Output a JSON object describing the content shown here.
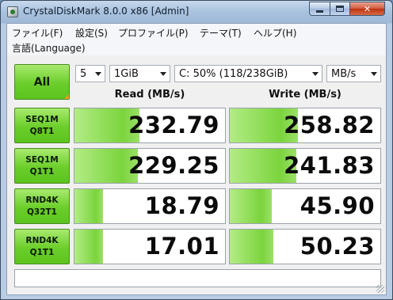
{
  "window": {
    "title": "CrystalDiskMark 8.0.0 x86 [Admin]",
    "caption_buttons": [
      "minimize-icon",
      "maximize-icon",
      "close-icon"
    ]
  },
  "menu": {
    "file": "ファイル(F)",
    "settings": "設定(S)",
    "profile": "プロファイル(P)",
    "theme": "テーマ(T)",
    "help": "ヘルプ(H)",
    "language": "言語(Language)"
  },
  "controls": {
    "all_label": "All",
    "count": "5",
    "size": "1GiB",
    "drive": "C: 50% (118/238GiB)",
    "unit": "MB/s"
  },
  "headers": {
    "read": "Read (MB/s)",
    "write": "Write (MB/s)"
  },
  "tests": [
    {
      "line1": "SEQ1M",
      "line2": "Q8T1",
      "read": "232.79",
      "write": "258.82",
      "read_fill": 0.43,
      "write_fill": 0.45
    },
    {
      "line1": "SEQ1M",
      "line2": "Q1T1",
      "read": "229.25",
      "write": "241.83",
      "read_fill": 0.42,
      "write_fill": 0.44
    },
    {
      "line1": "RND4K",
      "line2": "Q32T1",
      "read": "18.79",
      "write": "45.90",
      "read_fill": 0.19,
      "write_fill": 0.28
    },
    {
      "line1": "RND4K",
      "line2": "Q1T1",
      "read": "17.01",
      "write": "50.23",
      "read_fill": 0.19,
      "write_fill": 0.29
    }
  ],
  "comment": "",
  "colors": {
    "accent_green": "#6bce2a",
    "fill_green": "#7bd43d",
    "corner_orange": "#f29a22"
  }
}
